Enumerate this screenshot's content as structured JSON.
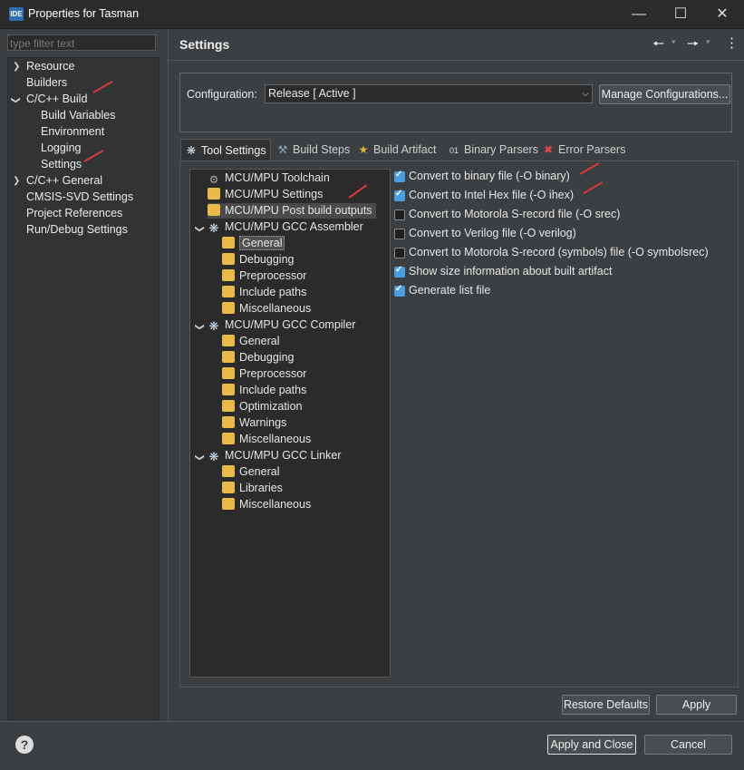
{
  "window": {
    "app_icon": "IDE",
    "title": "Properties for Tasman",
    "controls": [
      "minimize-icon",
      "maximize-icon",
      "close-icon"
    ]
  },
  "left": {
    "filter_placeholder": "type filter text",
    "nav": [
      {
        "label": "Resource",
        "expander": "collapsed"
      },
      {
        "label": "Builders"
      },
      {
        "label": "C/C++ Build",
        "expander": "expanded"
      },
      {
        "label": "Build Variables"
      },
      {
        "label": "Environment"
      },
      {
        "label": "Logging"
      },
      {
        "label": "Settings",
        "selected": true
      },
      {
        "label": "C/C++ General",
        "expander": "collapsed"
      },
      {
        "label": "CMSIS-SVD Settings"
      },
      {
        "label": "Project References"
      },
      {
        "label": "Run/Debug Settings"
      }
    ]
  },
  "header": {
    "title": "Settings",
    "icons": [
      "back-arrow-icon",
      "forward-arrow-icon",
      "menu-kebab-icon"
    ]
  },
  "config": {
    "label": "Configuration:",
    "value": "Release  [ Active ]",
    "manage_button": "Manage Configurations..."
  },
  "tabs": [
    {
      "label": "Tool Settings",
      "icon": "gear-icon",
      "active": true
    },
    {
      "label": "Build Steps",
      "icon": "hammer-icon"
    },
    {
      "label": "Build Artifact",
      "icon": "trophy-icon"
    },
    {
      "label": "Binary Parsers",
      "icon": "binary-icon"
    },
    {
      "label": "Error Parsers",
      "icon": "error-icon"
    }
  ],
  "tool_tree": [
    "MCU/MPU Toolchain",
    "MCU/MPU Settings",
    "MCU/MPU Post build outputs",
    "MCU/MPU GCC Assembler",
    "General",
    "Debugging",
    "Preprocessor",
    "Include paths",
    "Miscellaneous",
    "MCU/MPU GCC Compiler",
    "General",
    "Debugging",
    "Preprocessor",
    "Include paths",
    "Optimization",
    "Warnings",
    "Miscellaneous",
    "MCU/MPU GCC Linker",
    "General",
    "Libraries",
    "Miscellaneous"
  ],
  "options": [
    {
      "label": "Convert to binary file (-O binary)",
      "checked": true
    },
    {
      "label": "Convert to Intel Hex file (-O ihex)",
      "checked": true
    },
    {
      "label": "Convert to Motorola S-record file (-O srec)",
      "checked": false
    },
    {
      "label": "Convert to Verilog file (-O verilog)",
      "checked": false
    },
    {
      "label": "Convert to Motorola S-record (symbols) file (-O symbolsrec)",
      "checked": false
    },
    {
      "label": "Show size information about built artifact",
      "checked": true
    },
    {
      "label": "Generate list file",
      "checked": true
    }
  ],
  "buttons": {
    "restore_defaults": "Restore Defaults",
    "apply": "Apply",
    "apply_and_close": "Apply and Close",
    "cancel": "Cancel",
    "help": "?"
  },
  "colors": {
    "accent": "#4a9ee0",
    "annotation": "#d63a3a"
  }
}
